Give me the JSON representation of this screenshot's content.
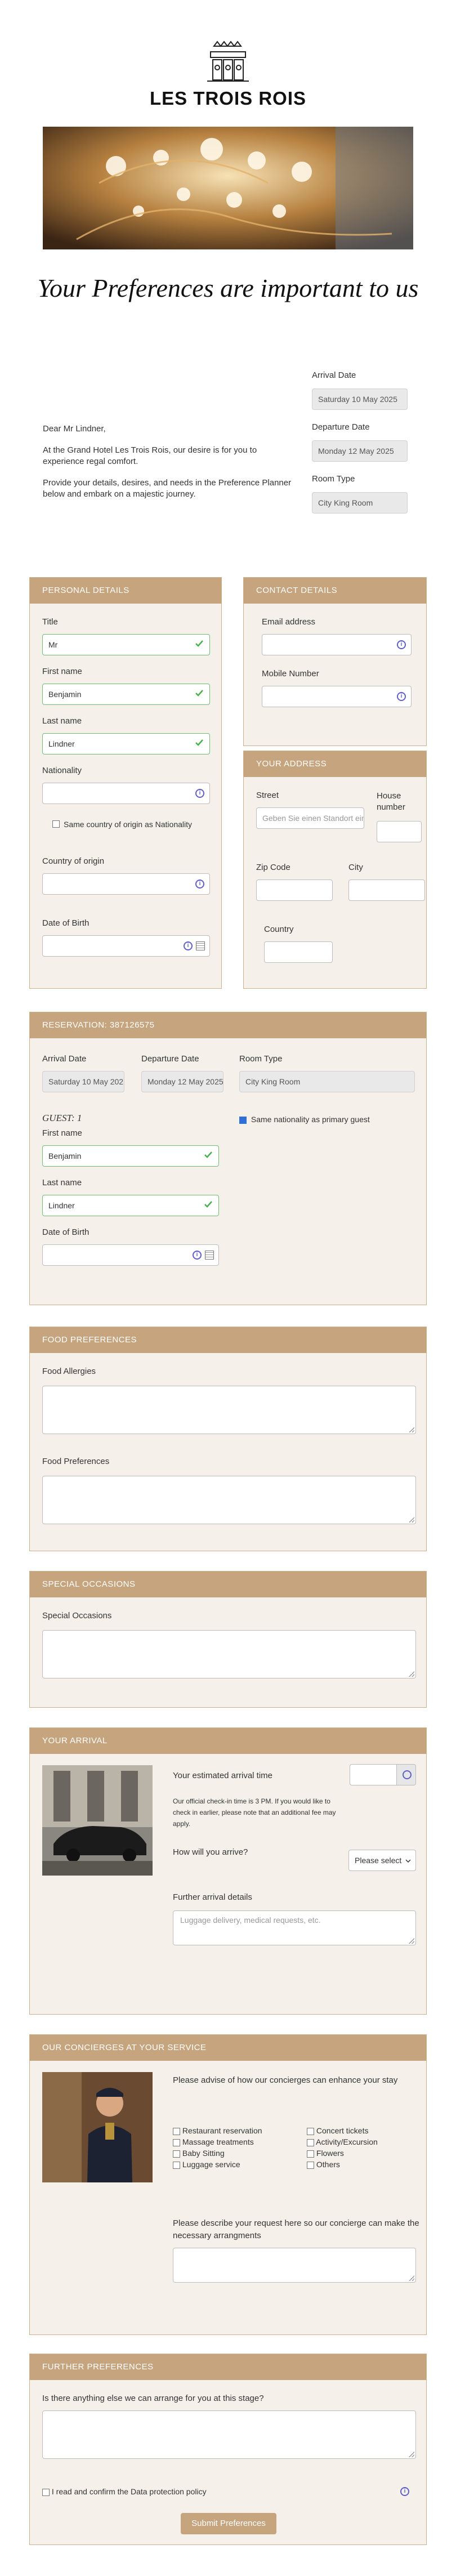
{
  "brand": {
    "name": "LES TROIS ROIS",
    "logo_icon": "crown-castle-logo"
  },
  "headline": "Your Preferences are important to us",
  "intro": {
    "greeting": "Dear Mr Lindner,",
    "p1": "At the Grand Hotel Les Trois Rois, our desire is for you to experience regal comfort.",
    "p2": "Provide your details, desires, and needs in the Preference Planner below and embark on a majestic journey."
  },
  "booking": {
    "arrival_label": "Arrival Date",
    "arrival_value": "Saturday 10 May 2025",
    "departure_label": "Departure Date",
    "departure_value": "Monday 12 May 2025",
    "room_label": "Room Type",
    "room_value": "City King Room"
  },
  "personal": {
    "header": "PERSONAL DETAILS",
    "title_label": "Title",
    "title_value": "Mr",
    "first_label": "First name",
    "first_value": "Benjamin",
    "last_label": "Last name",
    "last_value": "Lindner",
    "nationality_label": "Nationality",
    "same_country_label": "Same country of origin as Nationality",
    "country_label": "Country of origin",
    "dob_label": "Date of Birth"
  },
  "contact": {
    "header": "CONTACT DETAILS",
    "email_label": "Email address",
    "mobile_label": "Mobile Number"
  },
  "address": {
    "header": "YOUR ADDRESS",
    "street_label": "Street",
    "street_placeholder": "Geben Sie einen Standort ein",
    "house_label": "House number",
    "zip_label": "Zip Code",
    "city_label": "City",
    "country_label": "Country"
  },
  "reservation": {
    "header": "RESERVATION: 387126575",
    "arrival_label": "Arrival Date",
    "arrival_value": "Saturday 10 May 2025",
    "departure_label": "Departure Date",
    "departure_value": "Monday 12 May 2025",
    "room_label": "Room Type",
    "room_value": "City King Room",
    "guest_label": "GUEST: 1",
    "same_nationality_label": "Same nationality as primary guest",
    "first_label": "First name",
    "first_value": "Benjamin",
    "last_label": "Last name",
    "last_value": "Lindner",
    "dob_label": "Date of Birth"
  },
  "food": {
    "header": "FOOD PREFERENCES",
    "allergies_label": "Food Allergies",
    "prefs_label": "Food Preferences"
  },
  "occasions": {
    "header": "SPECIAL OCCASIONS",
    "label": "Special Occasions"
  },
  "arrival": {
    "header": "YOUR ARRIVAL",
    "time_label": "Your estimated arrival time",
    "note": "Our official check-in time is 3 PM. If you would like to check in earlier, please note that an additional fee may apply.",
    "how_label": "How will you arrive?",
    "how_value": "Please select",
    "details_label": "Further arrival details",
    "details_placeholder": "Luggage delivery, medical requests, etc."
  },
  "concierge": {
    "header": "OUR CONCIERGES AT YOUR SERVICE",
    "intro": "Please advise of how our concierges can enhance your stay",
    "options_left": [
      "Restaurant reservation",
      "Massage treatments",
      "Baby Sitting",
      "Luggage service"
    ],
    "options_right": [
      "Concert tickets",
      "Activity/Excursion",
      "Flowers",
      "Others"
    ],
    "request_label": "Please describe your request here so our concierge can make the necessary arrangments"
  },
  "further": {
    "header": "FURTHER PREFERENCES",
    "label": "Is there anything else we can arrange for you at this stage?",
    "privacy_label": "I read and confirm the Data protection policy"
  },
  "submit_label": "Submit Preferences",
  "colors": {
    "accent": "#c6a47e",
    "panel_bg": "#f5f1ea",
    "valid": "#6fbf73",
    "info": "#5f5fc9"
  }
}
